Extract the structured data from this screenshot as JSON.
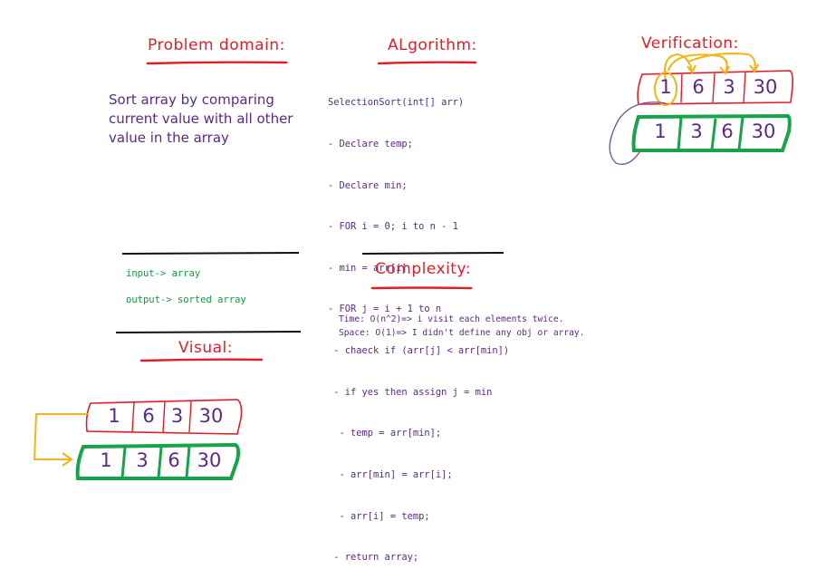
{
  "colors": {
    "heading": "#e11d2a",
    "text": "#5b2a86",
    "io": "#0f9a3f",
    "red_box": "#e11d2a",
    "green_box": "#18a34a",
    "arrow_yellow": "#f5b314",
    "arrow_purple": "#7a5a9a",
    "rule": "#111111"
  },
  "problem": {
    "title": "Problem domain:",
    "lines": [
      "Sort array by comparing",
      "current value with all other",
      "value in the array"
    ]
  },
  "algorithm": {
    "title": "ALgorithm:",
    "lines": [
      "SelectionSort(int[] arr)",
      "- Declare temp;",
      "- Declare min;",
      "- FOR i = 0; i to n - 1",
      "- min = arr[i]",
      "- FOR j = i + 1 to n",
      " - chaeck if (arr[j] < arr[min])",
      " - if yes then assign j = min",
      "  - temp = arr[min];",
      "  - arr[min] = arr[i];",
      "  - arr[i] = temp;",
      " - return array;"
    ]
  },
  "verification": {
    "title": "Verification:",
    "before": [
      "1",
      "6",
      "3",
      "30"
    ],
    "after": [
      "1",
      "3",
      "6",
      "30"
    ]
  },
  "io": {
    "input": "input-> array",
    "output": "output-> sorted array"
  },
  "complexity": {
    "title": "Complexity:",
    "time": "Time: O(n^2)=> i visit each elements twice.",
    "space": "Space: O(1)=> I didn't define any obj or array."
  },
  "visual": {
    "title": "Visual:",
    "before": [
      "1",
      "6",
      "3",
      "30"
    ],
    "after": [
      "1",
      "3",
      "6",
      "30"
    ]
  }
}
